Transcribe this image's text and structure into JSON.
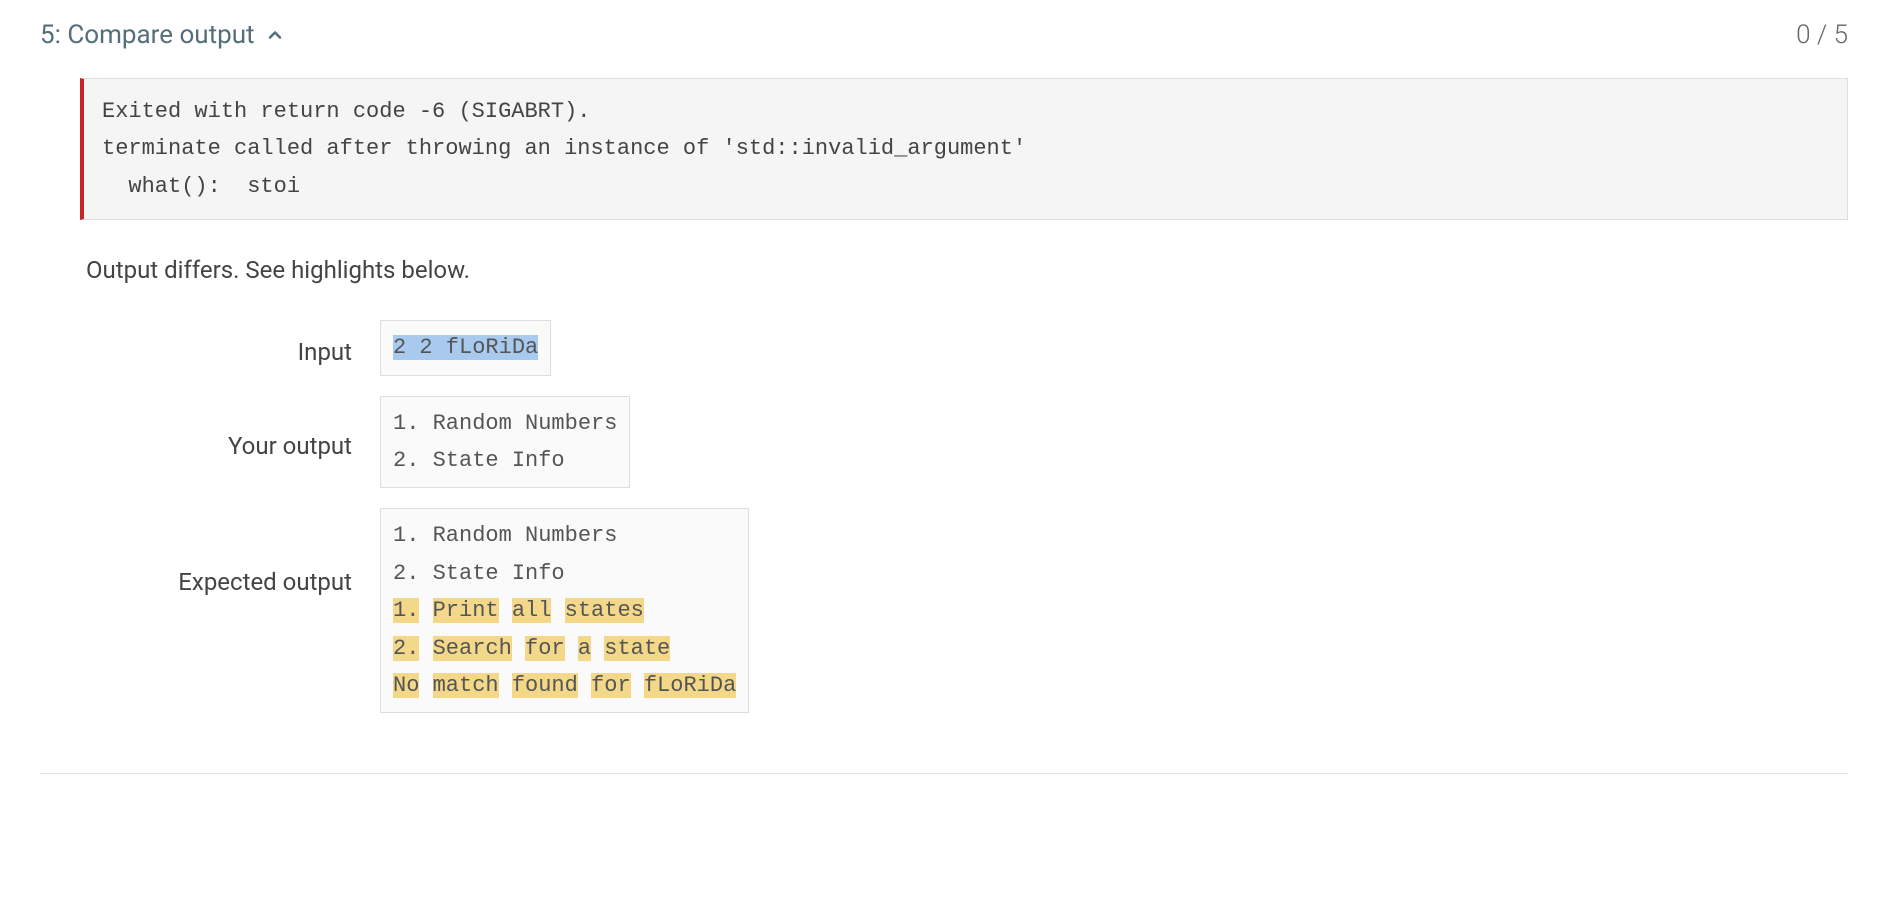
{
  "header": {
    "title": "5: Compare output",
    "chevron": "chevron-up-icon",
    "score": "0 / 5"
  },
  "error": {
    "line1": "Exited with return code -6 (SIGABRT).",
    "line2": "terminate called after throwing an instance of 'std::invalid_argument'",
    "line3": "  what():  stoi"
  },
  "differs_message": "Output differs. See highlights below.",
  "labels": {
    "input": "Input",
    "your_output": "Your output",
    "expected_output": "Expected output"
  },
  "input": {
    "value": "2 2 fLoRiDa"
  },
  "your_output": {
    "line1": "1. Random Numbers",
    "line2": "2. State Info"
  },
  "expected_output": {
    "line1": "1. Random Numbers",
    "line2": "2. State Info",
    "hl": {
      "t1": "1.",
      "t2": "Print",
      "t3": "all",
      "t4": "states",
      "t5": "2.",
      "t6": "Search",
      "t7": "for",
      "t8": "a",
      "t9": "state",
      "t10": "No",
      "t11": "match",
      "t12": "found",
      "t13": "for",
      "t14": "fLoRiDa"
    }
  }
}
